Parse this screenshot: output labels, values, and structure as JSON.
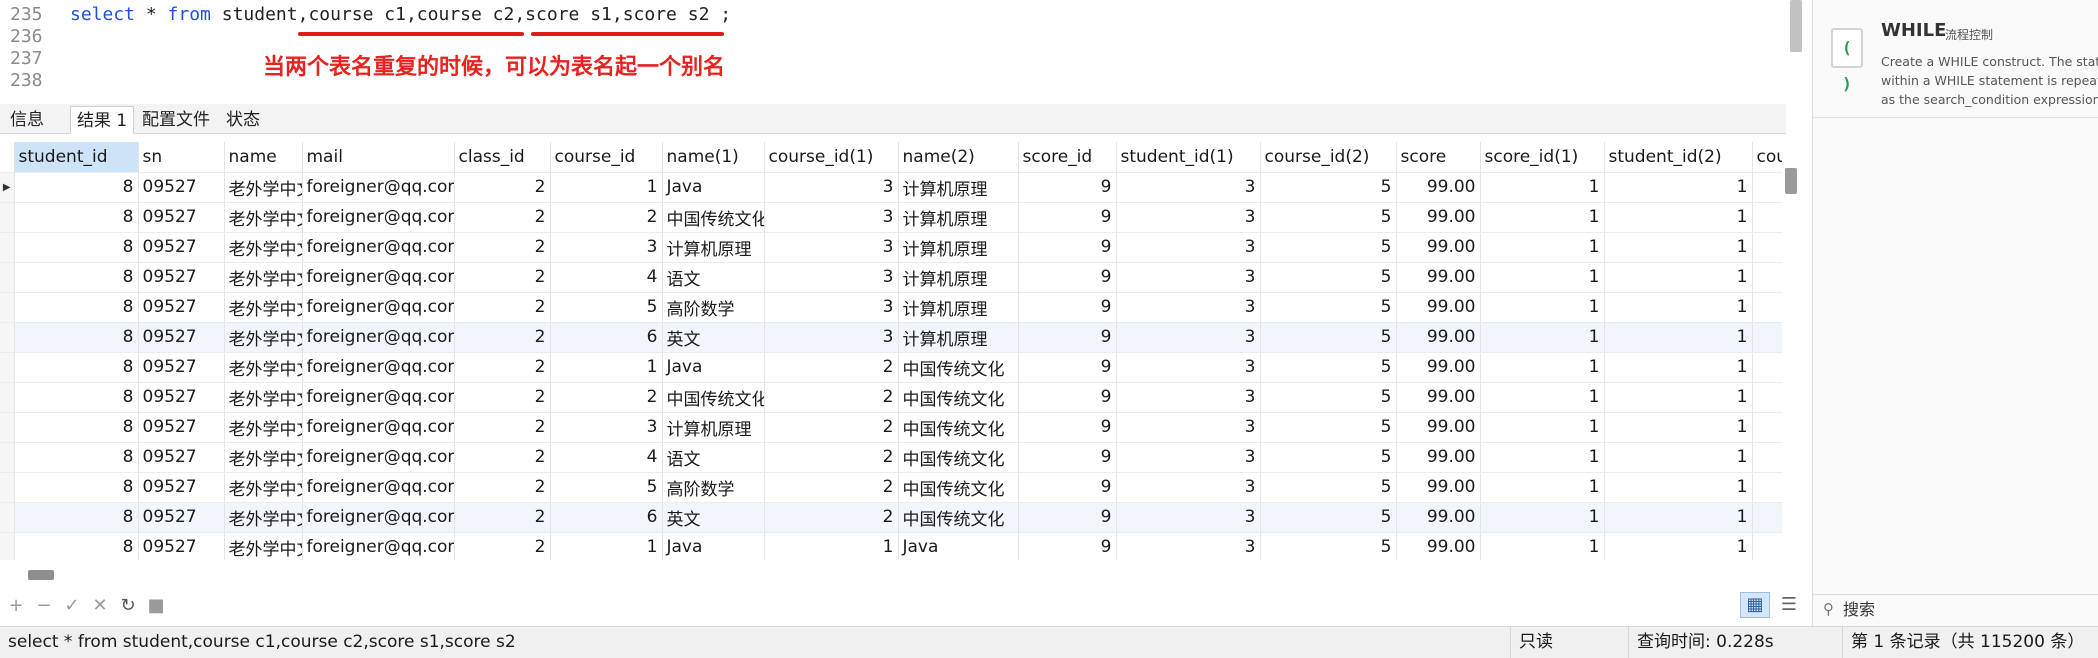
{
  "editor": {
    "lines": [
      {
        "num": "235",
        "tokens": [
          {
            "t": "select",
            "c": "kw"
          },
          {
            "t": " * ",
            "c": "tx"
          },
          {
            "t": "from",
            "c": "kw"
          },
          {
            "t": " student,course c1,course c2,score s1,score s2 ;",
            "c": "tx"
          }
        ]
      },
      {
        "num": "236",
        "tokens": []
      },
      {
        "num": "237",
        "tokens": []
      },
      {
        "num": "238",
        "tokens": []
      }
    ],
    "annotation": "当两个表名重复的时候，可以为表名起一个别名",
    "annotation_color": "#e8221f"
  },
  "tabs": [
    {
      "label": "信息",
      "active": false
    },
    {
      "label": "结果 1",
      "active": true
    },
    {
      "label": "配置文件",
      "active": false
    },
    {
      "label": "状态",
      "active": false
    }
  ],
  "grid": {
    "columns": [
      "student_id",
      "sn",
      "name",
      "mail",
      "class_id",
      "course_id",
      "name(1)",
      "course_id(1)",
      "name(2)",
      "score_id",
      "student_id(1)",
      "course_id(2)",
      "score",
      "score_id(1)",
      "student_id(2)",
      "cou"
    ],
    "selected_column": "student_id",
    "current_row_marker": "▶",
    "rows": [
      [
        "8",
        "09527",
        "老外学中文",
        "foreigner@qq.com",
        "2",
        "1",
        "Java",
        "3",
        "计算机原理",
        "9",
        "3",
        "5",
        "99.00",
        "1",
        "1",
        ""
      ],
      [
        "8",
        "09527",
        "老外学中文",
        "foreigner@qq.com",
        "2",
        "2",
        "中国传统文化",
        "3",
        "计算机原理",
        "9",
        "3",
        "5",
        "99.00",
        "1",
        "1",
        ""
      ],
      [
        "8",
        "09527",
        "老外学中文",
        "foreigner@qq.com",
        "2",
        "3",
        "计算机原理",
        "3",
        "计算机原理",
        "9",
        "3",
        "5",
        "99.00",
        "1",
        "1",
        ""
      ],
      [
        "8",
        "09527",
        "老外学中文",
        "foreigner@qq.com",
        "2",
        "4",
        "语文",
        "3",
        "计算机原理",
        "9",
        "3",
        "5",
        "99.00",
        "1",
        "1",
        ""
      ],
      [
        "8",
        "09527",
        "老外学中文",
        "foreigner@qq.com",
        "2",
        "5",
        "高阶数学",
        "3",
        "计算机原理",
        "9",
        "3",
        "5",
        "99.00",
        "1",
        "1",
        ""
      ],
      [
        "8",
        "09527",
        "老外学中文",
        "foreigner@qq.com",
        "2",
        "6",
        "英文",
        "3",
        "计算机原理",
        "9",
        "3",
        "5",
        "99.00",
        "1",
        "1",
        ""
      ],
      [
        "8",
        "09527",
        "老外学中文",
        "foreigner@qq.com",
        "2",
        "1",
        "Java",
        "2",
        "中国传统文化",
        "9",
        "3",
        "5",
        "99.00",
        "1",
        "1",
        ""
      ],
      [
        "8",
        "09527",
        "老外学中文",
        "foreigner@qq.com",
        "2",
        "2",
        "中国传统文化",
        "2",
        "中国传统文化",
        "9",
        "3",
        "5",
        "99.00",
        "1",
        "1",
        ""
      ],
      [
        "8",
        "09527",
        "老外学中文",
        "foreigner@qq.com",
        "2",
        "3",
        "计算机原理",
        "2",
        "中国传统文化",
        "9",
        "3",
        "5",
        "99.00",
        "1",
        "1",
        ""
      ],
      [
        "8",
        "09527",
        "老外学中文",
        "foreigner@qq.com",
        "2",
        "4",
        "语文",
        "2",
        "中国传统文化",
        "9",
        "3",
        "5",
        "99.00",
        "1",
        "1",
        ""
      ],
      [
        "8",
        "09527",
        "老外学中文",
        "foreigner@qq.com",
        "2",
        "5",
        "高阶数学",
        "2",
        "中国传统文化",
        "9",
        "3",
        "5",
        "99.00",
        "1",
        "1",
        ""
      ],
      [
        "8",
        "09527",
        "老外学中文",
        "foreigner@qq.com",
        "2",
        "6",
        "英文",
        "2",
        "中国传统文化",
        "9",
        "3",
        "5",
        "99.00",
        "1",
        "1",
        ""
      ],
      [
        "8",
        "09527",
        "老外学中文",
        "foreigner@qq.com",
        "2",
        "1",
        "Java",
        "1",
        "Java",
        "9",
        "3",
        "5",
        "99.00",
        "1",
        "1",
        ""
      ]
    ]
  },
  "toolbar": {
    "buttons": [
      {
        "name": "add-record-button",
        "icon": "plus-icon",
        "glyph": "+",
        "dark": false
      },
      {
        "name": "delete-record-button",
        "icon": "minus-icon",
        "glyph": "−",
        "dark": false
      },
      {
        "name": "apply-changes-button",
        "icon": "check-icon",
        "glyph": "✓",
        "dark": false
      },
      {
        "name": "discard-changes-button",
        "icon": "cross-icon",
        "glyph": "✕",
        "dark": false
      },
      {
        "name": "refresh-button",
        "icon": "refresh-icon",
        "glyph": "↻",
        "dark": true
      },
      {
        "name": "stop-button",
        "icon": "stop-icon",
        "glyph": "■",
        "dark": false
      }
    ]
  },
  "status": {
    "query": "select * from student,course c1,course c2,score s1,score s2",
    "readonly": "只读",
    "query_time": "查询时间: 0.228s",
    "record_info": "第 1 条记录（共 115200 条）"
  },
  "right_panel": {
    "snippet_title": "WHILE",
    "snippet_subtitle": "流程控制",
    "snippet_desc_lines": [
      "Create a WHILE construct. The statement list",
      "within a WHILE statement is repeated as long",
      "as the search_condition expression is true."
    ],
    "snippet_icon_glyph": "( )",
    "search_placeholder": "搜索"
  }
}
